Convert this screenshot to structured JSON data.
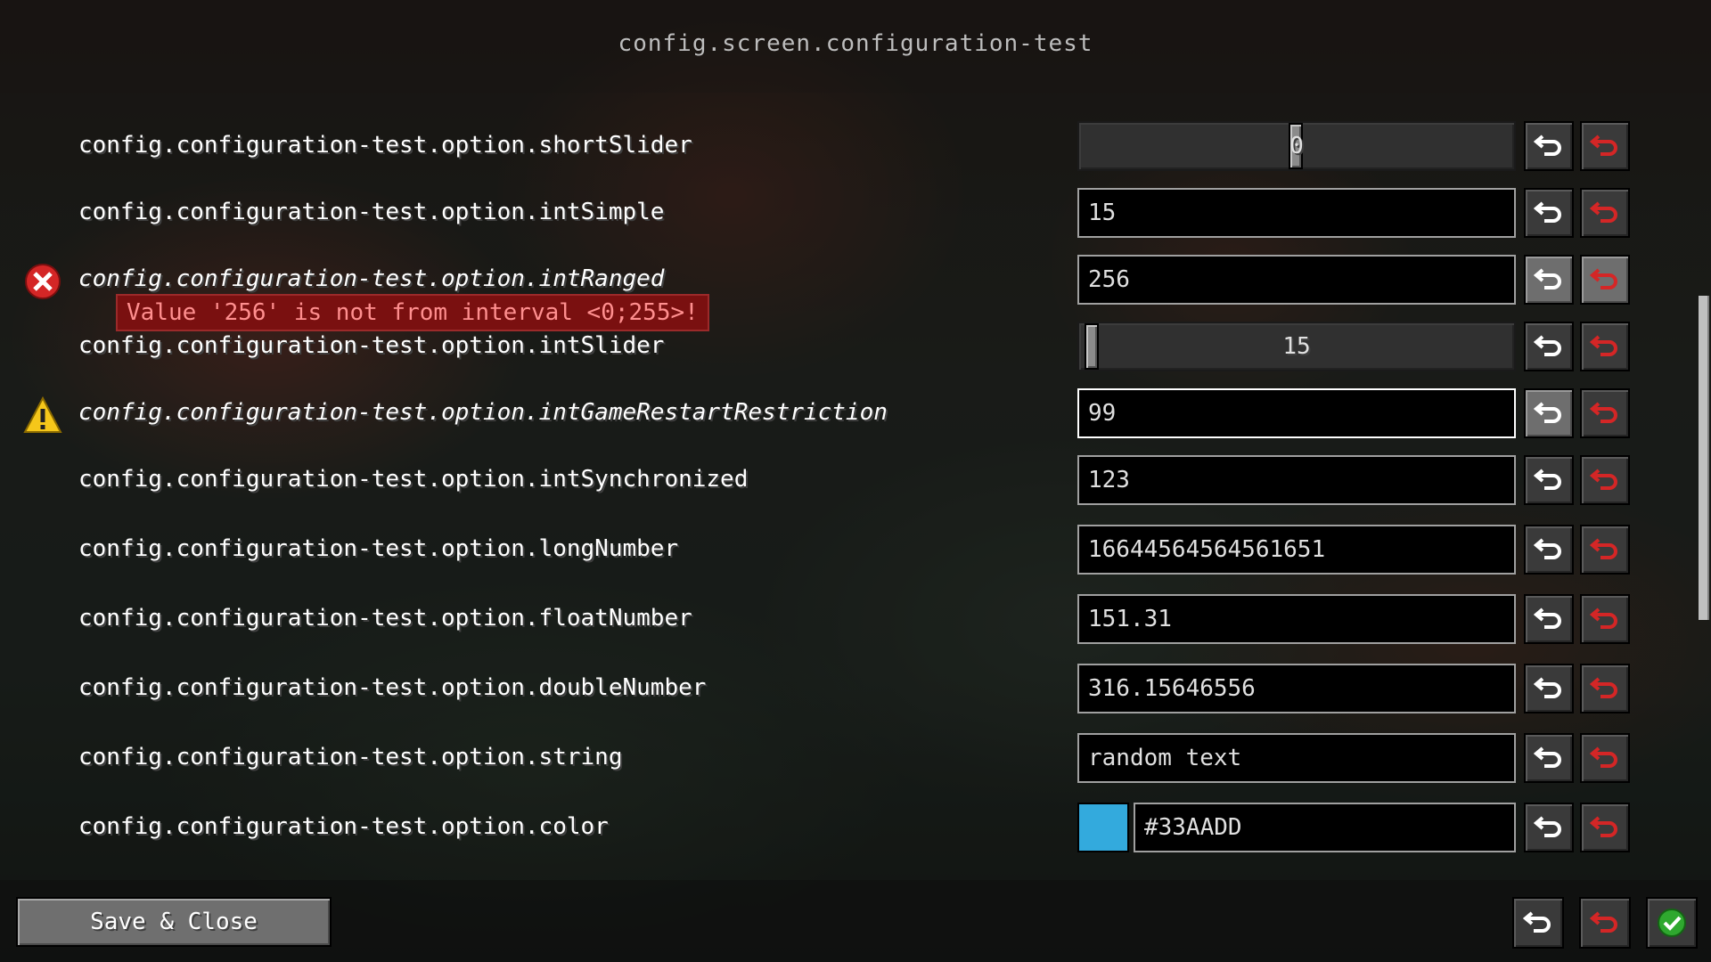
{
  "header": {
    "title": "config.screen.configuration-test"
  },
  "options": [
    {
      "label": "config.configuration-test.option.shortSlider",
      "control": "slider",
      "value": "0"
    },
    {
      "label": "config.configuration-test.option.intSimple",
      "control": "text",
      "value": "15"
    },
    {
      "label": "config.configuration-test.option.intRanged",
      "control": "text",
      "value": "256",
      "status": "error"
    },
    {
      "label": "config.configuration-test.option.intSlider",
      "control": "slider",
      "value": "15"
    },
    {
      "label": "config.configuration-test.option.intGameRestartRestriction",
      "control": "text",
      "value": "99",
      "status": "warning"
    },
    {
      "label": "config.configuration-test.option.intSynchronized",
      "control": "text",
      "value": "123"
    },
    {
      "label": "config.configuration-test.option.longNumber",
      "control": "text",
      "value": "16644564564561651"
    },
    {
      "label": "config.configuration-test.option.floatNumber",
      "control": "text",
      "value": "151.31"
    },
    {
      "label": "config.configuration-test.option.doubleNumber",
      "control": "text",
      "value": "316.15646556"
    },
    {
      "label": "config.configuration-test.option.string",
      "control": "text",
      "value": "random text"
    },
    {
      "label": "config.configuration-test.option.color",
      "control": "color",
      "value": "#33AADD"
    }
  ],
  "error_tooltip": "Value '256' is not from interval <0;255>!",
  "footer": {
    "save_close_label": "Save & Close"
  },
  "icons": {
    "reset": "undo-arrow-icon",
    "restore_default": "red-undo-arrow-icon",
    "error": "red-x-icon",
    "warning": "yellow-warning-icon",
    "confirm": "green-check-icon"
  },
  "colors": {
    "color_swatch": "#33AADD",
    "error_red": "#d42626",
    "warning_yellow": "#f5c71a",
    "confirm_green": "#2fa82f",
    "error_text": "#ff8f8f"
  }
}
